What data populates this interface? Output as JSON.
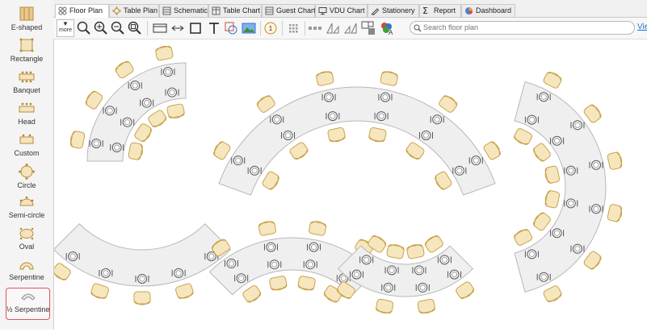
{
  "palette": {
    "items": [
      {
        "label": "E-shaped",
        "icon": "e-shaped-table-icon"
      },
      {
        "label": "Rectangle",
        "icon": "rectangle-table-icon"
      },
      {
        "label": "Banquet",
        "icon": "banquet-table-icon"
      },
      {
        "label": "Head",
        "icon": "head-table-icon"
      },
      {
        "label": "Custom",
        "icon": "custom-table-icon"
      },
      {
        "label": "Circle",
        "icon": "circle-table-icon"
      },
      {
        "label": "Semi-circle",
        "icon": "semi-circle-table-icon"
      },
      {
        "label": "Oval",
        "icon": "oval-table-icon"
      },
      {
        "label": "Serpentine",
        "icon": "serpentine-table-icon"
      },
      {
        "label": "½ Serpentine",
        "icon": "half-serpentine-table-icon",
        "selected": true
      }
    ]
  },
  "tabs": [
    {
      "label": "Floor Plan",
      "icon": "floor-plan-icon",
      "active": true
    },
    {
      "label": "Table Plan",
      "icon": "table-plan-icon"
    },
    {
      "label": "Schematic",
      "icon": "schematic-icon"
    },
    {
      "label": "Table Chart",
      "icon": "table-chart-icon"
    },
    {
      "label": "Guest Chart",
      "icon": "guest-chart-icon"
    },
    {
      "label": "VDU Chart",
      "icon": "vdu-chart-icon"
    },
    {
      "label": "Stationery",
      "icon": "stationery-icon"
    },
    {
      "label": "Report",
      "icon": "report-icon"
    },
    {
      "label": "Dashboard",
      "icon": "dashboard-icon"
    }
  ],
  "toolbar": {
    "more_label": "more",
    "search_placeholder": "Search floor plan",
    "view_link": "Vie"
  },
  "colors": {
    "chair_fill": "#f6e6bd",
    "chair_stroke": "#c9a24e",
    "table_fill": "#efefef",
    "table_stroke": "#b8b8b8",
    "selected_border": "#e0525a",
    "link": "#1e6fd9"
  }
}
